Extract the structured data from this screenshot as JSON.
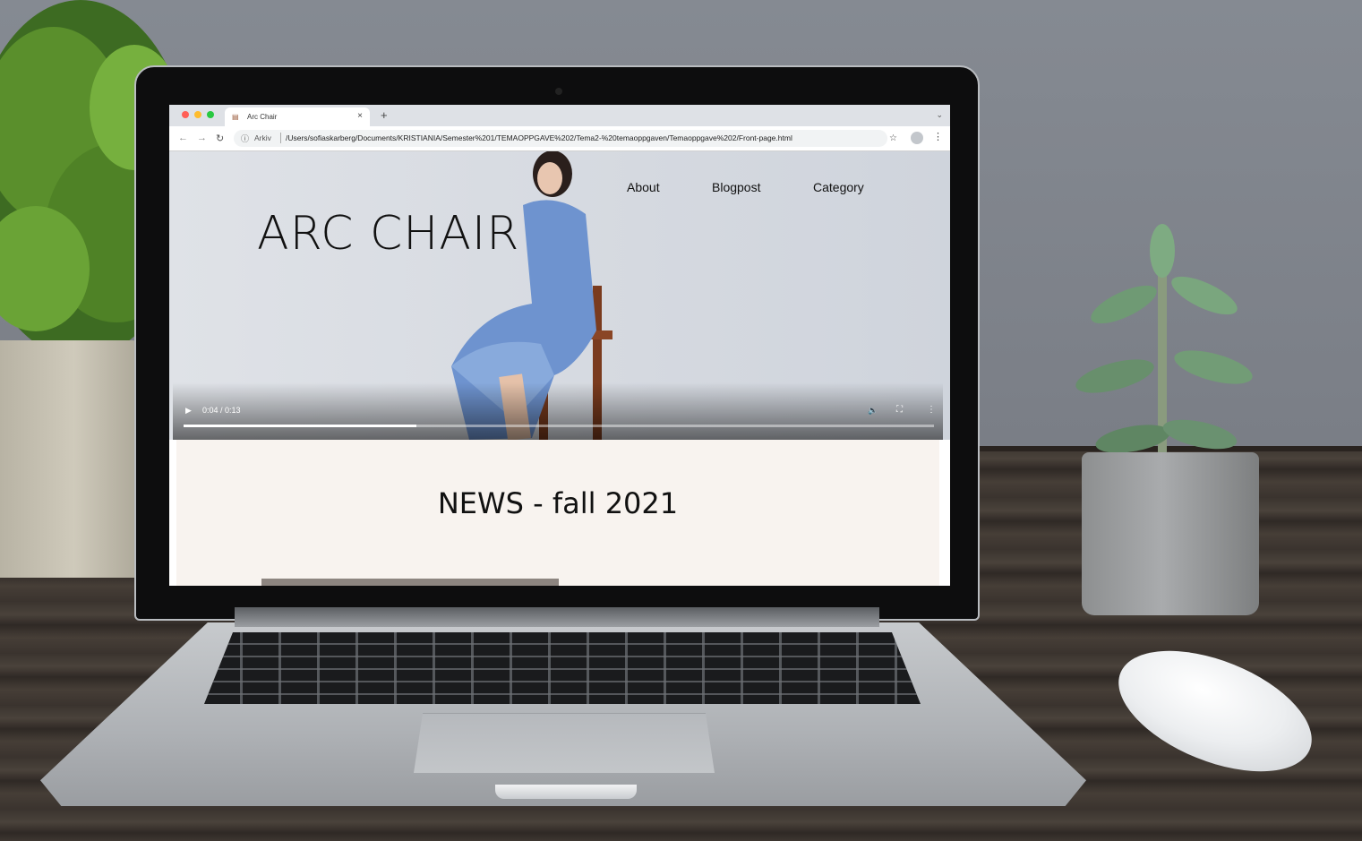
{
  "browser": {
    "tab_title": "Arc Chair",
    "tab_close": "×",
    "new_tab": "+",
    "omnibox_scheme_label": "Arkiv",
    "url": "/Users/sofiaskarberg/Documents/KRISTIANIA/Semester%201/TEMAOPPGAVE%202/Tema2-%20temaoppgaven/Temaoppgave%202/Front-page.html",
    "window_dots": [
      "#ff5f57",
      "#febc2e",
      "#28c840"
    ]
  },
  "site": {
    "title": "ARC CHAIR",
    "nav": [
      "About",
      "Blogpost",
      "Category"
    ]
  },
  "video": {
    "time": "0:04 / 0:13",
    "progress_fraction": 0.31
  },
  "news": {
    "title": "NEWS - fall 2021"
  }
}
